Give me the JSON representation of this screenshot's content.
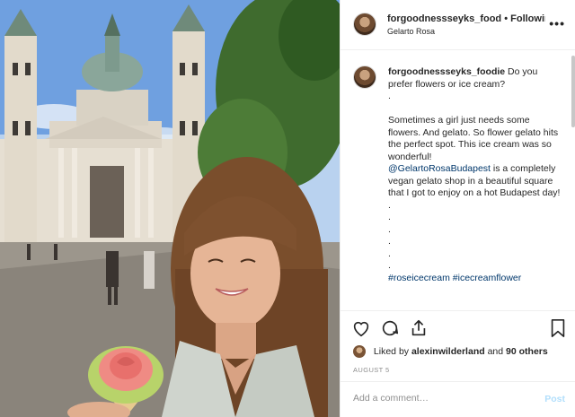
{
  "post": {
    "username": "forgoodnessseyks_food",
    "separator": "•",
    "follow_label": "Following",
    "location": "Gelarto Rosa",
    "more_icon": "ellipsis-icon"
  },
  "caption": {
    "username": "forgoodnessseyks_foodie",
    "first_line": "Do you prefer flowers or ice cream?",
    "dot": ".",
    "body_1": "Sometimes a girl just needs some flowers. And gelato. So flower gelato hits the perfect spot. This ice cream was so wonderful!",
    "mention": "@GelartoRosaBudapest",
    "body_2": "is a completely vegan gelato shop in a beautiful square that I got to enjoy on a hot Budapest day!",
    "tag_1": "#roseicecream",
    "tag_2": "#icecreamflower"
  },
  "actions": {
    "icons": [
      "heart-icon",
      "comment-icon",
      "share-icon",
      "bookmark-icon"
    ],
    "liked_prefix": "Liked by",
    "liked_user": "alexinwilderland",
    "liked_and": "and",
    "liked_others": "90 others",
    "date": "AUGUST 5"
  },
  "comment_box": {
    "placeholder": "Add a comment…",
    "post_label": "Post"
  },
  "colors": {
    "link": "#00376b",
    "post_disabled": "#b2dffc",
    "secondary_text": "#8e8e8e"
  }
}
